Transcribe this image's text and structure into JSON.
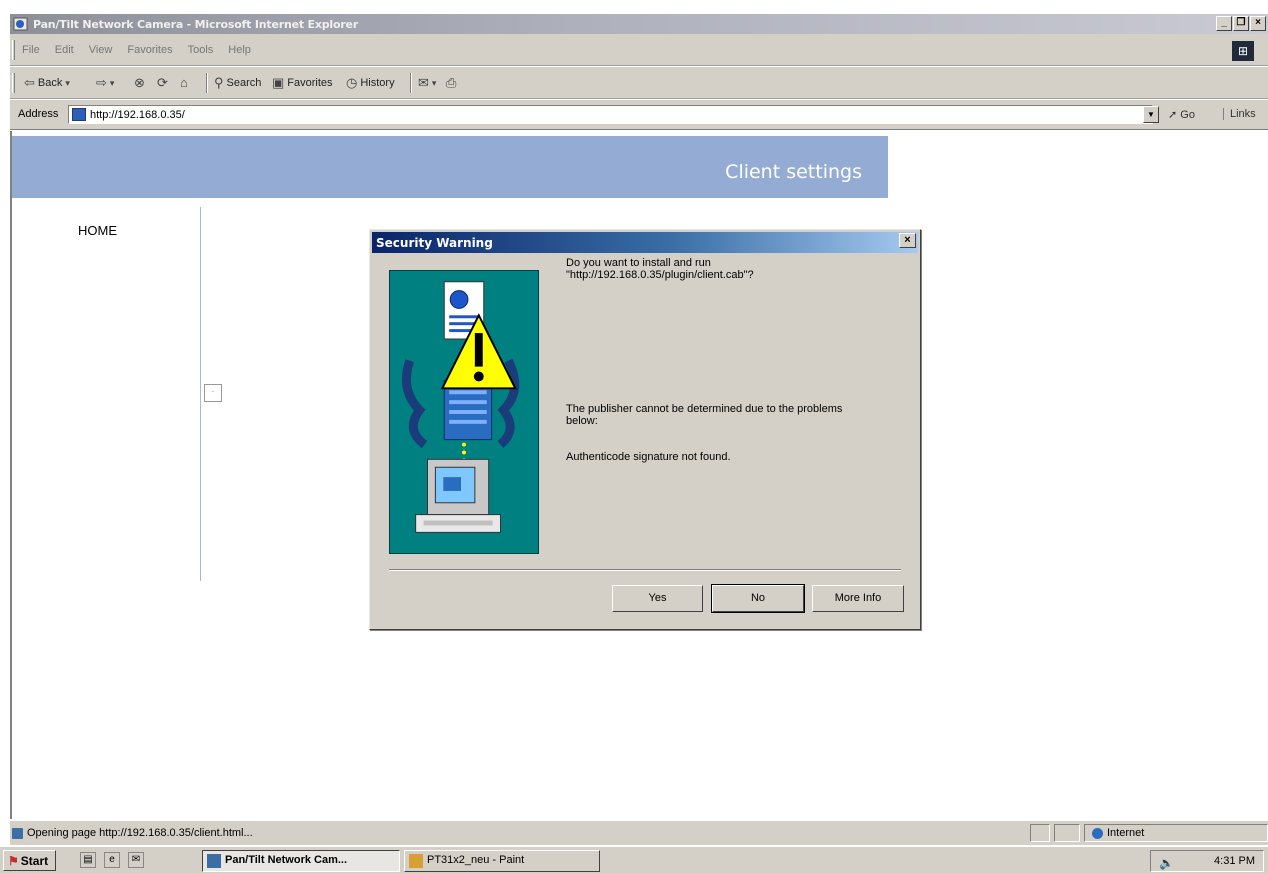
{
  "window": {
    "title": "Pan/Tilt Network Camera - Microsoft Internet Explorer",
    "controls": {
      "minimize": "_",
      "maximize": "❐",
      "close": "×"
    }
  },
  "menubar": {
    "items": [
      "File",
      "Edit",
      "View",
      "Favorites",
      "Tools",
      "Help"
    ]
  },
  "toolbar": {
    "back_label": "Back",
    "search_label": "Search",
    "favorites_label": "Favorites",
    "history_label": "History"
  },
  "addressbar": {
    "label": "Address",
    "url": "http://192.168.0.35/",
    "go_label": "Go",
    "links_label": "Links"
  },
  "page": {
    "banner_title": "Client settings",
    "nav_home": "HOME"
  },
  "dialog": {
    "title": "Security Warning",
    "message_line1": "Do you want to install and run",
    "message_line2": "\"http://192.168.0.35/plugin/client.cab\"?",
    "publisher_line1": "The publisher cannot be determined due to the problems",
    "publisher_line2": "below:",
    "signature_message": "Authenticode signature not found.",
    "buttons": {
      "yes": "Yes",
      "no": "No",
      "more_info": "More Info"
    }
  },
  "statusbar": {
    "text": "Opening page http://192.168.0.35/client.html...",
    "zone": "Internet"
  },
  "taskbar": {
    "start_label": "Start",
    "tasks": [
      {
        "label": "Pan/Tilt Network Cam...",
        "active": true
      },
      {
        "label": "PT31x2_neu - Paint",
        "active": false
      }
    ],
    "clock": "4:31 PM"
  },
  "colors": {
    "banner": "#94acd4",
    "dialog_title_start": "#0a246a",
    "art_background": "#008080",
    "chrome": "#d4d0c8"
  }
}
